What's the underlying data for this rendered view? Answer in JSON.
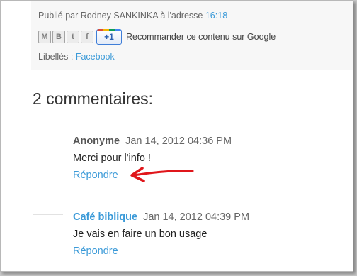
{
  "post_footer": {
    "byline_prefix": "Publié par Rodney SANKINKA à l'adresse",
    "time": "16:18",
    "share_icons": [
      "gmail-icon",
      "blogger-icon",
      "twitter-icon",
      "facebook-icon"
    ],
    "share_glyphs": [
      "M",
      "B",
      "t",
      "f"
    ],
    "plusone_label": "+1",
    "recommend_text": "Recommander ce contenu sur Google",
    "labels_prefix": "Libellés :",
    "label": "Facebook"
  },
  "comments": {
    "title": "2 commentaires:",
    "items": [
      {
        "author": "Anonyme",
        "date": "Jan 14, 2012 04:36 PM",
        "text": "Merci pour l'info !",
        "reply": "Répondre"
      },
      {
        "author": "Café biblique",
        "date": "Jan 14, 2012 04:39 PM",
        "text": "Je vais en faire un bon usage",
        "reply": "Répondre"
      }
    ]
  },
  "colors": {
    "link": "#3b9ad8",
    "annotation_arrow": "#e0161b"
  }
}
